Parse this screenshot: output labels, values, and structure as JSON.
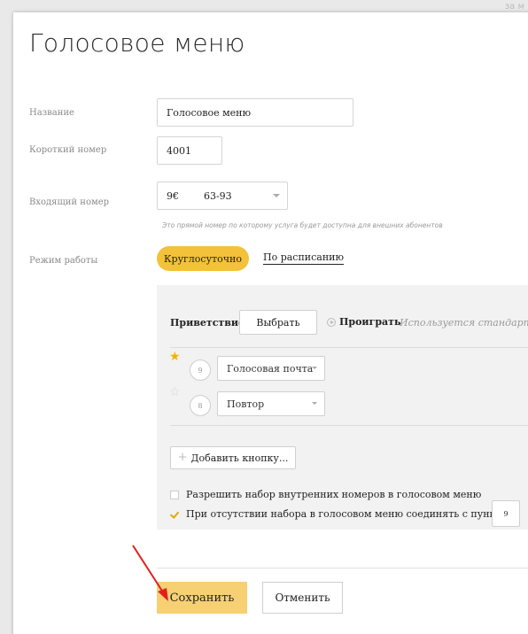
{
  "background_hint": "за м",
  "dialog": {
    "title": "Голосовое меню",
    "name": {
      "label": "Название",
      "value": "Голосовое меню"
    },
    "short_number": {
      "label": "Короткий номер",
      "value": "4001"
    },
    "incoming_number": {
      "label": "Входящий номер",
      "value": "9€        63-93",
      "hint": "Это прямой номер по которому услуга будет доступна для внешних абонентов"
    },
    "mode": {
      "label": "Режим работы",
      "active_tab": "Круглосуточно",
      "other_tab": "По расписанию"
    },
    "panel": {
      "greeting_label": "Приветствие",
      "choose_button": "Выбрать",
      "play_label": "Проиграть",
      "standard_text": "Используется стандартно",
      "menu_items": [
        {
          "key": "9",
          "action": "Голосовая почта",
          "starred": true
        },
        {
          "key": "8",
          "action": "Повтор",
          "starred": false
        }
      ],
      "add_button": "Добавить кнопку...",
      "allow_internal": {
        "label": "Разрешить набор внутренних номеров в голосовом меню",
        "checked": false
      },
      "connect_on_no_input": {
        "label": "При отсутствии набора в голосовом меню соединять с пунктом",
        "checked": true,
        "value": "9"
      }
    },
    "save_button": "Сохранить",
    "cancel_button": "Отменить"
  },
  "colors": {
    "accent": "#f3c13a",
    "save_bg": "#f6d072",
    "arrow": "#e02020",
    "star_on": "#f3b400"
  }
}
